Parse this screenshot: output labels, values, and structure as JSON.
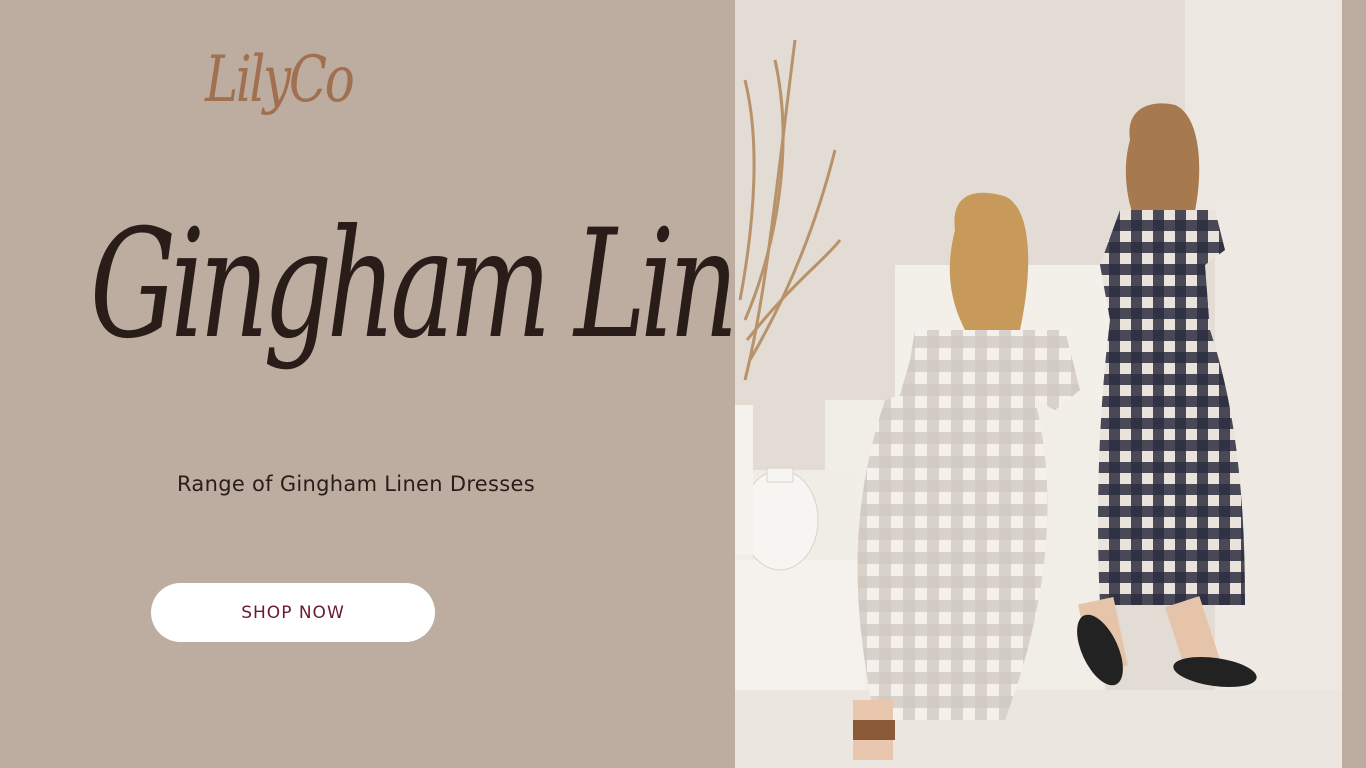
{
  "brand": {
    "logo_text": "LilyCo",
    "logo_color": "#a0704f"
  },
  "hero": {
    "headline": "Gingham Linen",
    "subtitle": "Range of Gingham Linen Dresses",
    "cta_label": "SHOP NOW"
  },
  "colors": {
    "background": "#bcada0",
    "headline": "#2a1d19",
    "button_bg": "#ffffff",
    "button_text": "#6b1a2e"
  },
  "photo": {
    "subject": "two women wearing gingham linen dresses on white steps"
  }
}
